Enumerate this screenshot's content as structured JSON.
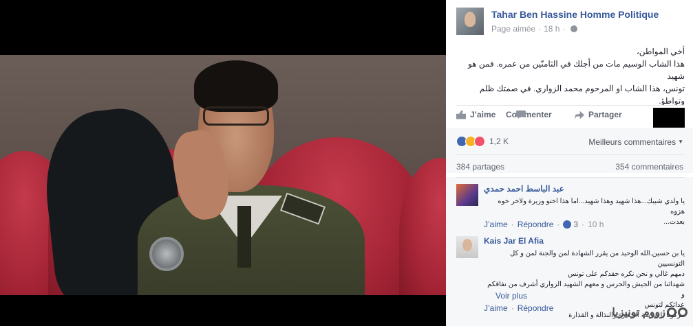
{
  "post": {
    "page_name": "Tahar Ben Hassine Homme Politique",
    "status": "Page aimée",
    "time": "18 h",
    "text_lines": [
      "أخي المواطن،",
      "هذا الشاب الوسيم مات من أجلك في الثامنّين من عمره. فمن هو شهيد",
      "تونس، هذا الشاب او المرحوم محمد الزواري. في صمتك ظلم وتواطؤ."
    ]
  },
  "actions": {
    "like": "J’aime",
    "comment": "Commenter",
    "share": "Partager"
  },
  "stats": {
    "reactions_count": "1,2 K",
    "sort_label": "Meilleurs commentaires",
    "shares": "384 partages",
    "comments": "354 commentaires"
  },
  "comments": [
    {
      "author": "عبد الباسط احمد حمدي",
      "text_lines": [
        "يا ولدي شبيك...هذا شهيد وهذا شهيد...اما هذا اختو وزيرة ولاخر خوه هزوه",
        "بعدت..."
      ],
      "like_label": "J’aime",
      "reply_label": "Répondre",
      "likes": "3",
      "time": "10 h"
    },
    {
      "author": "Kais Jar El Afia",
      "text_lines": [
        "يا بن حسين.الله الوحيد من يقرر الشهادة لمن والجنة لمن و كل التونسيين",
        "دمهم غالي و نحن نكره حقدكم على تونس",
        "شهدائنا من الجيش والحرس و معهم الشهيد الزواري أشرف من نفاقكم و",
        "عدائكم لتونس",
        "اتركونا يا ساسة الحقارة والنذالة و القذارة"
      ],
      "see_more": "Voir plus",
      "like_label": "J’aime",
      "reply_label": "Répondre"
    }
  ],
  "watermark": "زووم تونيزيا",
  "colors": {
    "link_blue": "#365899",
    "like_blue": "#4267b2",
    "muted": "#90949c",
    "panel_bg": "#f6f7f9"
  }
}
